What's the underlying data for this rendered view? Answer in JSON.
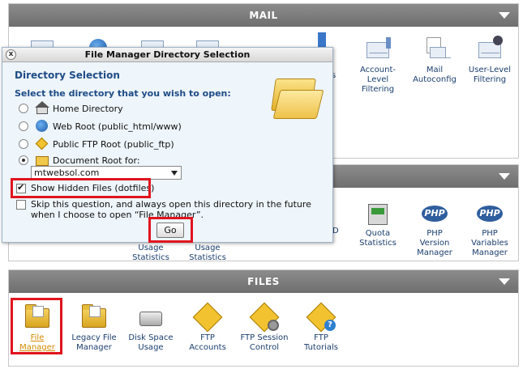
{
  "panels": {
    "mail": {
      "title": "MAIL"
    },
    "middle": {
      "title": ""
    },
    "files": {
      "title": "FILES"
    }
  },
  "mail_icons": [
    {
      "label": "Account-\nLevel\nFiltering",
      "icon": "mail-filter-icon"
    },
    {
      "label": "Mail\nAutoconfig",
      "icon": "mail-autoconfig-icon"
    },
    {
      "label": "User-Level\nFiltering",
      "icon": "user-filter-icon"
    }
  ],
  "mail_partial_label": "s",
  "mail_partial_label2": "s",
  "metrics_icons": [
    {
      "label": "Usage\nStatistics"
    },
    {
      "label": "Usage\nStatistics"
    },
    {
      "label": "Quota\nStatistics",
      "icon": "quota-icon"
    },
    {
      "label": "PHP\nVersion\nManager",
      "icon": "php-icon"
    },
    {
      "label": "PHP\nVariables\nManager",
      "icon": "php-icon"
    }
  ],
  "metrics_partial_label": "D",
  "php_text": "PHP",
  "files_icons": [
    {
      "label": "File\nManager",
      "icon": "file-manager-icon"
    },
    {
      "label": "Legacy File\nManager",
      "icon": "legacy-file-manager-icon"
    },
    {
      "label": "Disk Space\nUsage",
      "icon": "disk-space-icon"
    },
    {
      "label": "FTP\nAccounts",
      "icon": "ftp-accounts-icon"
    },
    {
      "label": "FTP Session\nControl",
      "icon": "ftp-session-icon"
    },
    {
      "label": "FTP\nTutorials",
      "icon": "ftp-tutorials-icon"
    }
  ],
  "dialog": {
    "title": "File Manager Directory Selection",
    "close_glyph": "x",
    "heading": "Directory Selection",
    "prompt": "Select the directory that you wish to open:",
    "options": [
      {
        "label": "Home Directory",
        "selected": false
      },
      {
        "label": "Web Root (public_html/www)",
        "selected": false
      },
      {
        "label": "Public FTP Root (public_ftp)",
        "selected": false
      },
      {
        "label": "Document Root for:",
        "selected": true
      }
    ],
    "domain_value": "mtwebsol.com",
    "show_hidden_label": "Show Hidden Files (dotfiles)",
    "show_hidden_checked": true,
    "skip_label": "Skip this question, and always open this directory in the future when I choose to open “File Manager”.",
    "skip_checked": false,
    "go_label": "Go"
  },
  "colors": {
    "header_bg": "#7d7d7d",
    "highlight": "#e0141e",
    "dialog_bg": "#eef5fb",
    "link": "#1a3d6e",
    "active_link": "#d48a00"
  }
}
